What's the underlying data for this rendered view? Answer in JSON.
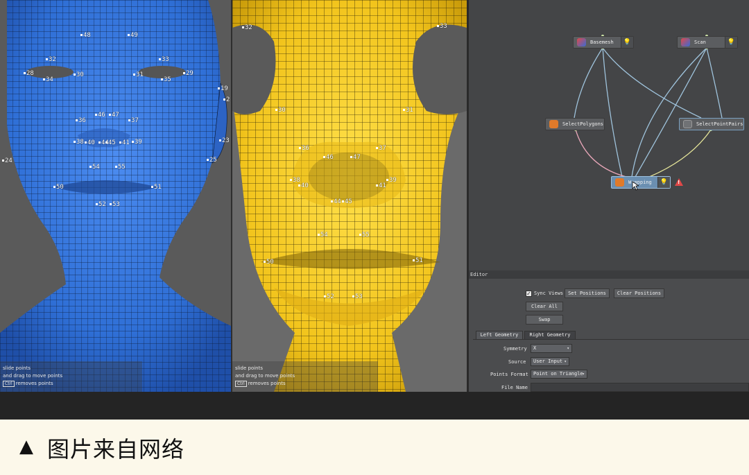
{
  "viewports": {
    "left": {
      "mesh_color": "#3478e0",
      "landmarks": [
        "48",
        "49",
        "32",
        "33",
        "28",
        "30",
        "31",
        "29",
        "34",
        "35",
        "19",
        "2",
        "46",
        "47",
        "36",
        "37",
        "38",
        "40",
        "44",
        "45",
        "41",
        "39",
        "23",
        "24",
        "25",
        "54",
        "55",
        "50",
        "51",
        "52",
        "53"
      ],
      "hints": [
        "slide points",
        "and drag to move points",
        "removes points"
      ],
      "hint_key": "Ctrl"
    },
    "middle": {
      "mesh_color": "#f2cb24",
      "landmarks": [
        "32",
        "33",
        "30",
        "31",
        "36",
        "37",
        "46",
        "47",
        "38",
        "40",
        "41",
        "39",
        "44",
        "45",
        "54",
        "55",
        "50",
        "51",
        "52",
        "53"
      ],
      "hints": [
        "slide points",
        "and drag to move points",
        "removes points"
      ],
      "hint_key": "Ctrl"
    }
  },
  "graph": {
    "nodes": {
      "basemesh": "Basemesh",
      "scan": "Scan",
      "select_polygons": "SelectPolygons",
      "select_point_pairs": "SelectPointPairs",
      "wrapping": "Wrapping"
    },
    "warning_glyph": "!",
    "bulb_glyph": "💡"
  },
  "editor": {
    "title": "Editor",
    "sync_views": "Sync Views",
    "sync_checked": "✓",
    "set_positions": "Set Positions",
    "clear_positions": "Clear Positions",
    "clear_all": "Clear All",
    "swap": "Swap",
    "tabs": [
      "Left Geometry",
      "Right Geometry"
    ],
    "symmetry_label": "Symmetry",
    "symmetry_value": "X",
    "source_label": "Source",
    "source_value": "User Input",
    "points_format_label": "Points Format",
    "points_format_value": "Point on Triangle",
    "file_name_label": "File Name"
  },
  "caption": {
    "triangle": "▲",
    "text": "图片来自网络"
  },
  "colors": {
    "graph_bg": "#444547",
    "accent_selected": "#6b8fb1",
    "warning": "#e04848"
  }
}
